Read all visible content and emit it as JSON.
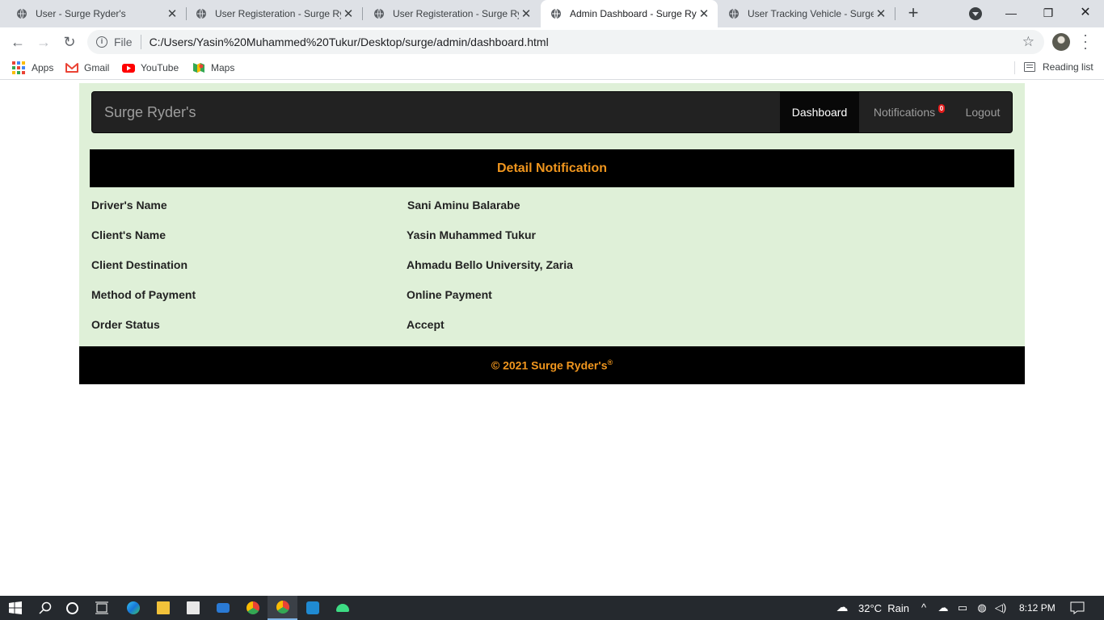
{
  "browser": {
    "tabs": [
      {
        "title": "User - Surge Ryder's",
        "active": false
      },
      {
        "title": "User Registeration - Surge Ry",
        "active": false
      },
      {
        "title": "User Registeration - Surge Ry",
        "active": false
      },
      {
        "title": "Admin Dashboard - Surge Ry",
        "active": true
      },
      {
        "title": "User Tracking Vehicle - Surge",
        "active": false
      }
    ],
    "address": {
      "scheme": "File",
      "url": "C:/Users/Yasin%20Muhammed%20Tukur/Desktop/surge/admin/dashboard.html"
    },
    "bookmarks": [
      {
        "label": "Apps",
        "icon": "apps-grid-icon"
      },
      {
        "label": "Gmail",
        "icon": "gmail-icon"
      },
      {
        "label": "YouTube",
        "icon": "youtube-icon"
      },
      {
        "label": "Maps",
        "icon": "maps-icon"
      }
    ],
    "reading_list": "Reading list"
  },
  "navbar": {
    "brand": "Surge Ryder's",
    "items": [
      {
        "label": "Dashboard",
        "active": true
      },
      {
        "label": "Notifications",
        "active": false,
        "badge": "0"
      },
      {
        "label": "Logout",
        "active": false
      }
    ]
  },
  "detail": {
    "heading": "Detail Notification",
    "rows": [
      {
        "label": "Driver's Name",
        "value": "Sani Aminu Balarabe"
      },
      {
        "label": "Client's Name",
        "value": "Yasin Muhammed Tukur"
      },
      {
        "label": "Client Destination",
        "value": "Ahmadu Bello University, Zaria"
      },
      {
        "label": "Method of Payment",
        "value": "Online Payment"
      },
      {
        "label": "Order Status",
        "value": "Accept"
      }
    ]
  },
  "footer": {
    "text": "© 2021 Surge Ryder's",
    "mark": "®"
  },
  "taskbar": {
    "weather": "32°C  Rain",
    "time": "8:12 PM"
  },
  "colors": {
    "container_bg": "#dff0d8",
    "navbar_bg": "#222222",
    "heading_text": "#f0961e",
    "heading_bg": "#000000"
  }
}
